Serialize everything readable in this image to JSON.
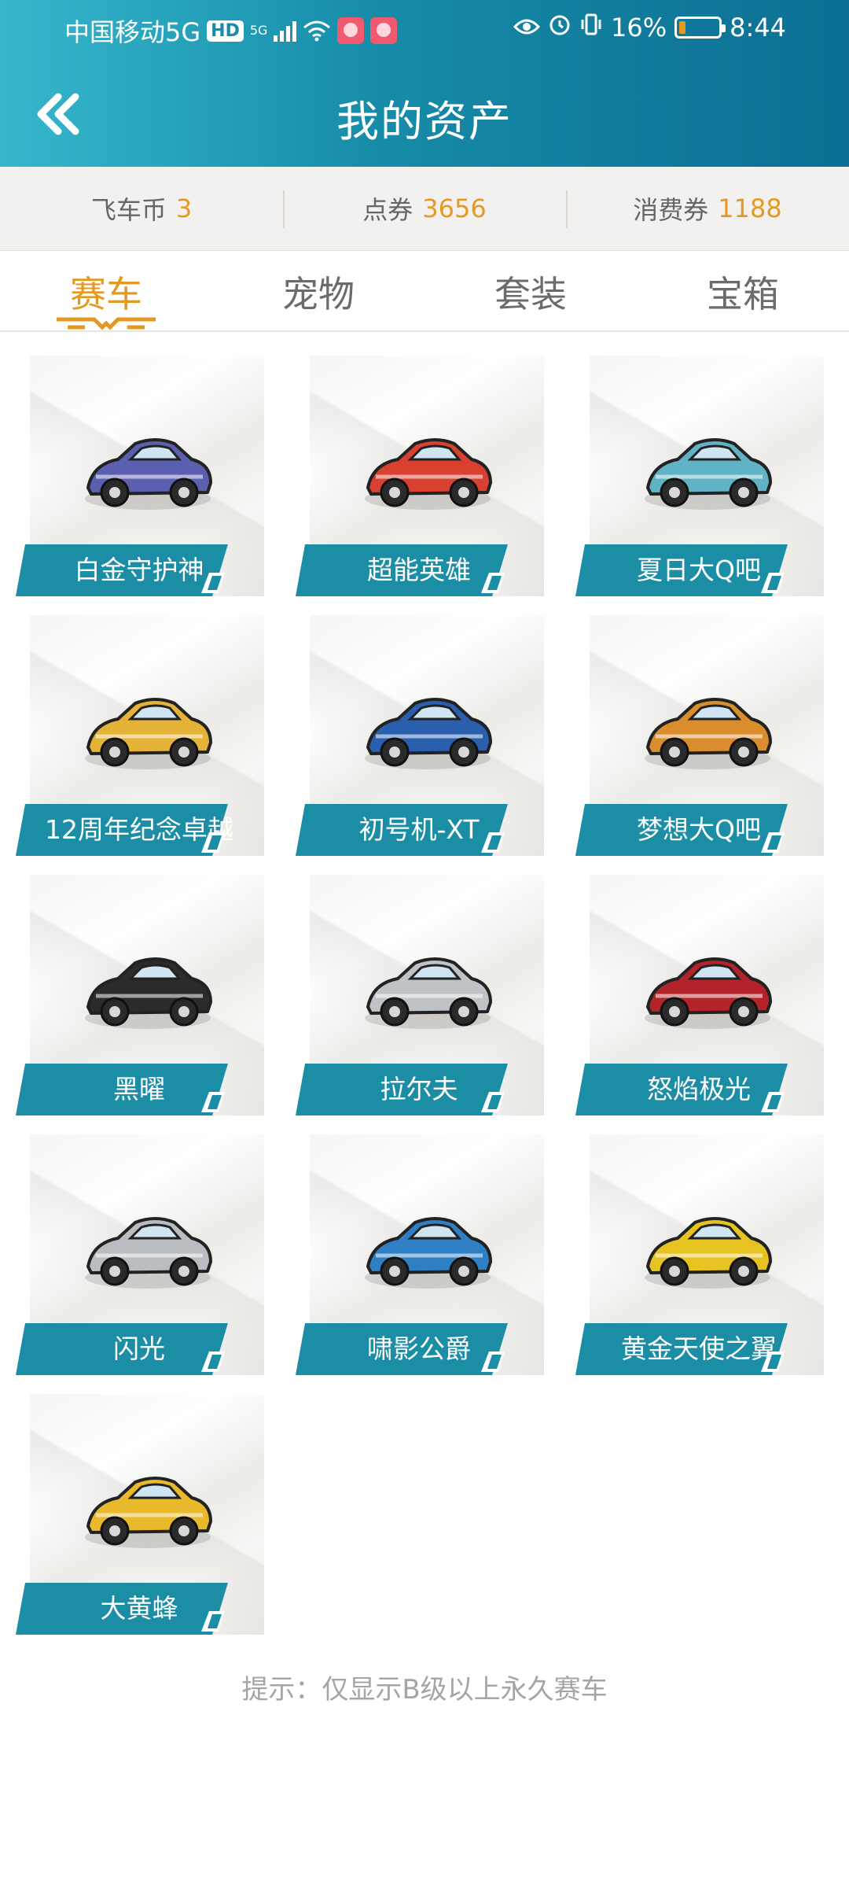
{
  "status_bar": {
    "carrier": "中国移动5G",
    "hd": "HD",
    "network_small": "5G",
    "battery": "16%",
    "time": "8:44"
  },
  "header": {
    "title": "我的资产"
  },
  "currencies": [
    {
      "label": "飞车币",
      "value": "3"
    },
    {
      "label": "点券",
      "value": "3656"
    },
    {
      "label": "消费券",
      "value": "1188"
    }
  ],
  "tabs": [
    {
      "label": "赛车"
    },
    {
      "label": "宠物"
    },
    {
      "label": "套装"
    },
    {
      "label": "宝箱"
    }
  ],
  "cars": [
    {
      "name": "白金守护神",
      "icon": "car-platinum-guardian-icon",
      "color": "#5b5fb0"
    },
    {
      "name": "超能英雄",
      "icon": "car-super-hero-icon",
      "color": "#d8402f"
    },
    {
      "name": "夏日大Q吧",
      "icon": "car-summer-q-icon",
      "color": "#5fb3c4"
    },
    {
      "name": "12周年纪念卓越",
      "icon": "car-12th-anniversary-icon",
      "color": "#e3b237"
    },
    {
      "name": "初号机-XT",
      "icon": "car-unit01-xt-icon",
      "color": "#2a5fae"
    },
    {
      "name": "梦想大Q吧",
      "icon": "car-dream-q-icon",
      "color": "#d98d2d"
    },
    {
      "name": "黑曜",
      "icon": "car-obsidian-icon",
      "color": "#2b2b2b"
    },
    {
      "name": "拉尔夫",
      "icon": "car-ralph-icon",
      "color": "#bfc3c7"
    },
    {
      "name": "怒焰极光",
      "icon": "car-fury-aurora-icon",
      "color": "#b3242a"
    },
    {
      "name": "闪光",
      "icon": "car-flash-icon",
      "color": "#b9bcc0"
    },
    {
      "name": "啸影公爵",
      "icon": "car-shadow-duke-icon",
      "color": "#2f7fc4"
    },
    {
      "name": "黄金天使之翼",
      "icon": "car-golden-angel-wing-icon",
      "color": "#e7c321"
    },
    {
      "name": "大黄蜂",
      "icon": "car-bumblebee-icon",
      "color": "#e7b92b"
    }
  ],
  "hint": "提示：仅显示B级以上永久赛车",
  "colors": {
    "header_start": "#36b7cc",
    "header_end": "#0c6f93",
    "accent": "#e39a22",
    "ribbon": "#1b8ea6"
  }
}
